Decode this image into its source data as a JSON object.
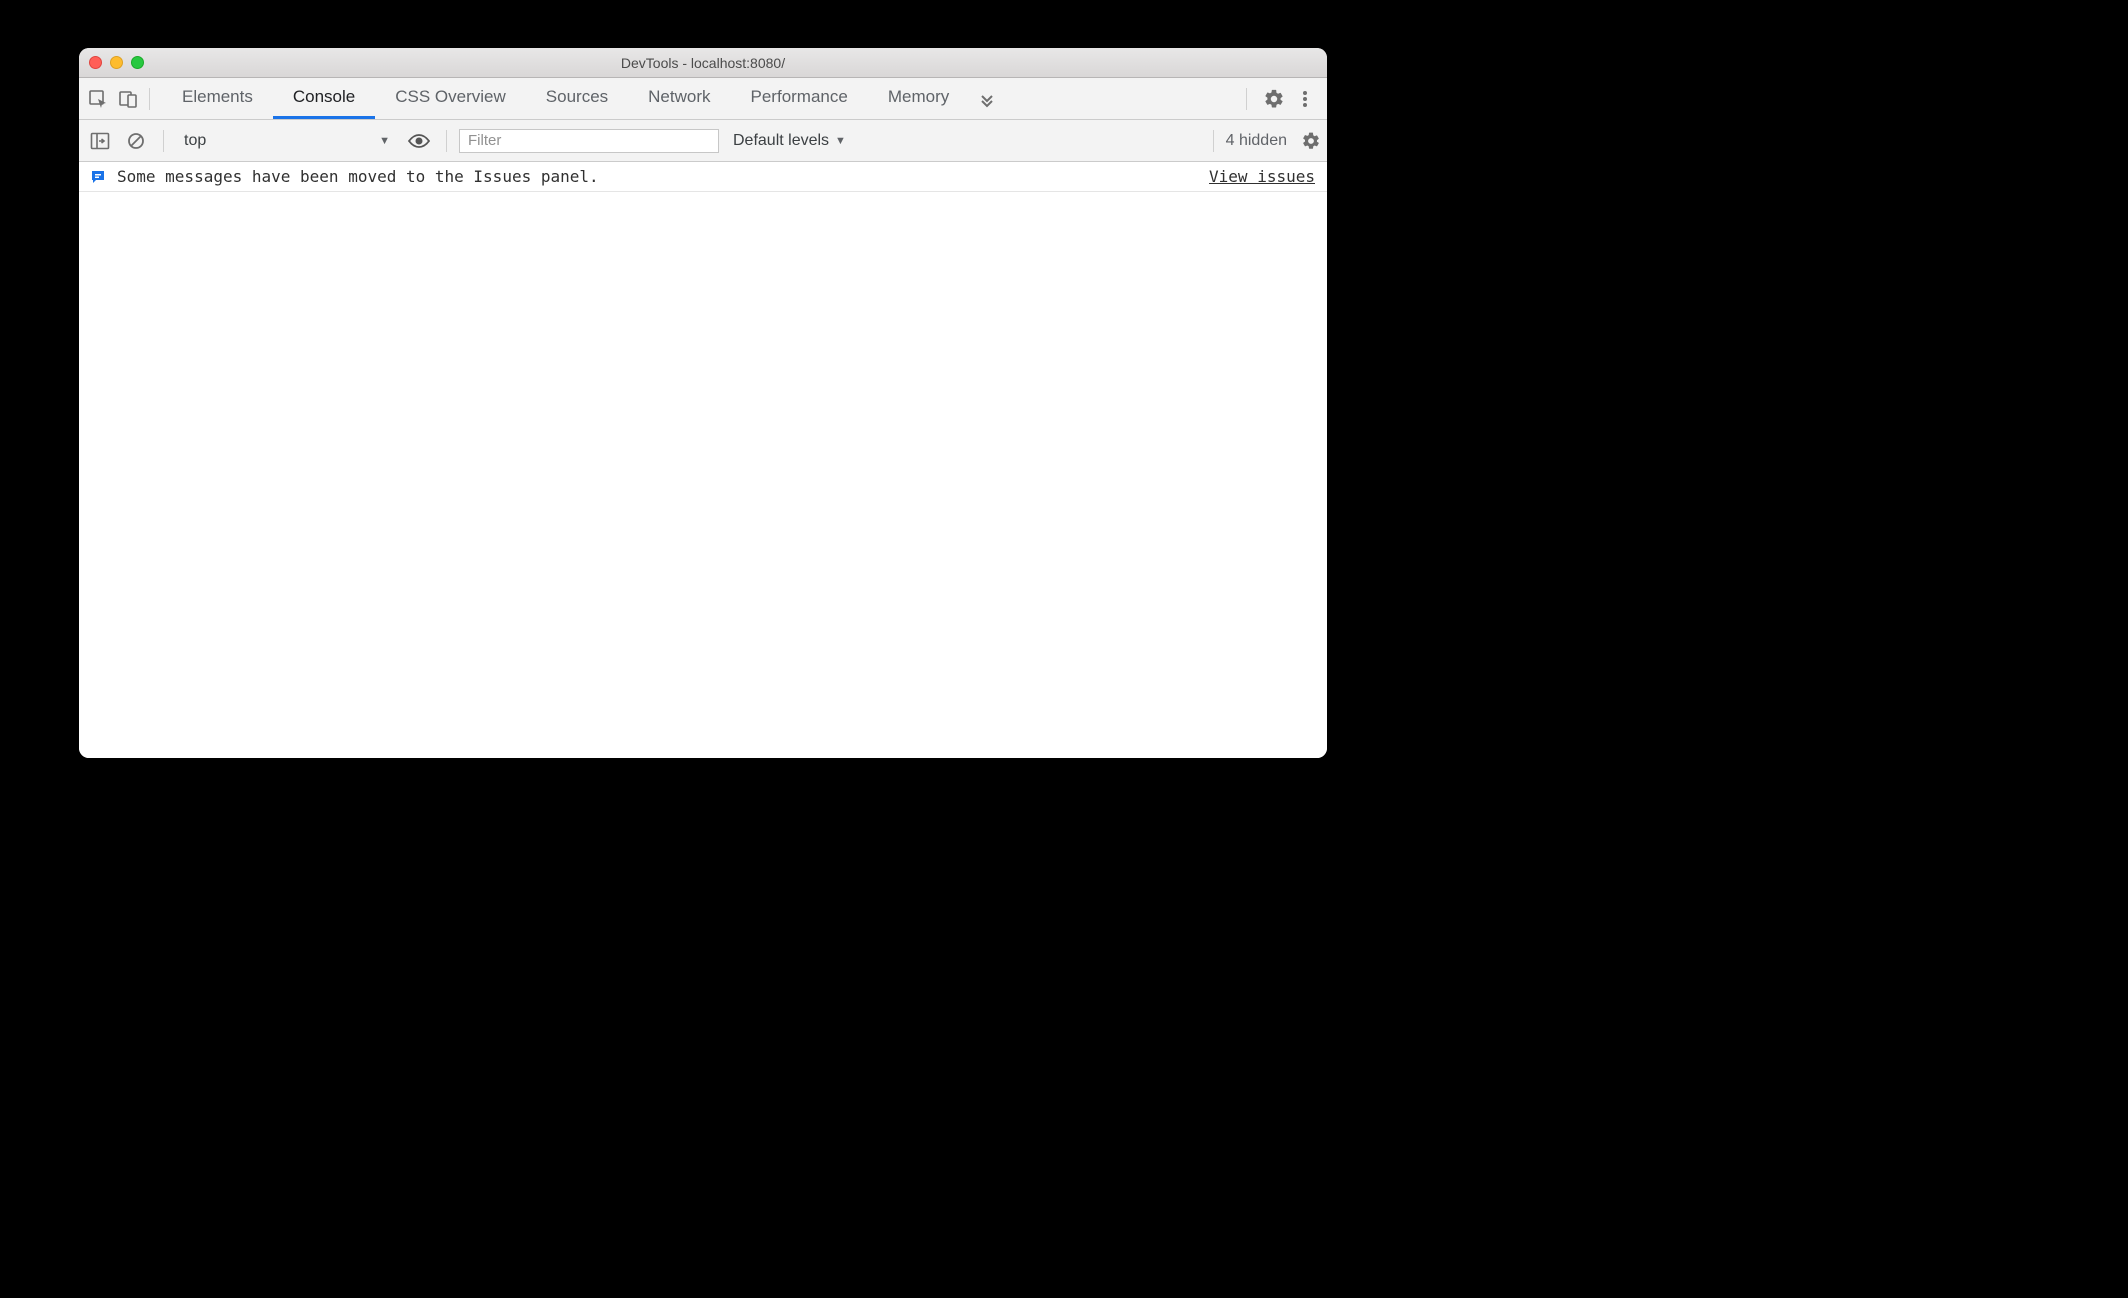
{
  "window": {
    "title": "DevTools - localhost:8080/"
  },
  "tabs": [
    "Elements",
    "Console",
    "CSS Overview",
    "Sources",
    "Network",
    "Performance",
    "Memory"
  ],
  "active_tab_index": 1,
  "console_toolbar": {
    "context": "top",
    "filter_placeholder": "Filter",
    "levels_label": "Default levels",
    "hidden_label": "4 hidden"
  },
  "issues": {
    "message": "Some messages have been moved to the Issues panel.",
    "view_label": "View issues"
  }
}
